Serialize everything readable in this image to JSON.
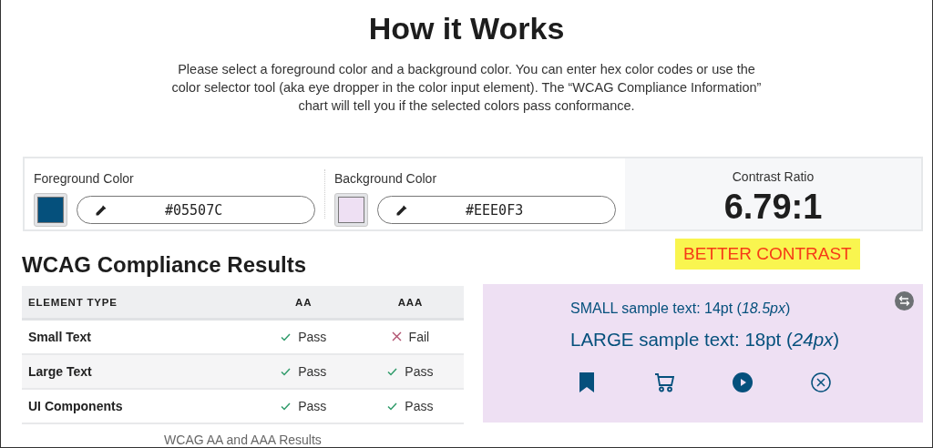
{
  "header": {
    "title": "How it Works",
    "intro": "Please select a foreground color and a background color. You can enter hex color codes or use the color selector tool (aka eye dropper in the color input element). The “WCAG Compliance Information” chart will tell you if the selected colors pass conformance."
  },
  "pickers": [
    {
      "label": "Foreground Color",
      "value": "#05507C",
      "color": "#05507c"
    },
    {
      "label": "Background Color",
      "value": "#EEE0F3",
      "color": "#eee0f3"
    }
  ],
  "contrast": {
    "label": "Contrast Ratio",
    "value": "6.79:1"
  },
  "callout": "BETTER CONTRAST",
  "results": {
    "heading": "WCAG Compliance Results",
    "columns": [
      "ELEMENT TYPE",
      "AA",
      "AAA"
    ],
    "rows": [
      {
        "element": "Small Text",
        "aa": {
          "text": "Pass",
          "pass": true
        },
        "aaa": {
          "text": "Fail",
          "pass": false
        }
      },
      {
        "element": "Large Text",
        "aa": {
          "text": "Pass",
          "pass": true
        },
        "aaa": {
          "text": "Pass",
          "pass": true
        }
      },
      {
        "element": "UI Components",
        "aa": {
          "text": "Pass",
          "pass": true
        },
        "aaa": {
          "text": "Pass",
          "pass": true
        }
      }
    ],
    "caption": "WCAG AA and AAA Results"
  },
  "sample": {
    "small": "SMALL sample text: 14pt (*18.5px*)",
    "large": "LARGE sample text: 18pt (*24px*)"
  }
}
